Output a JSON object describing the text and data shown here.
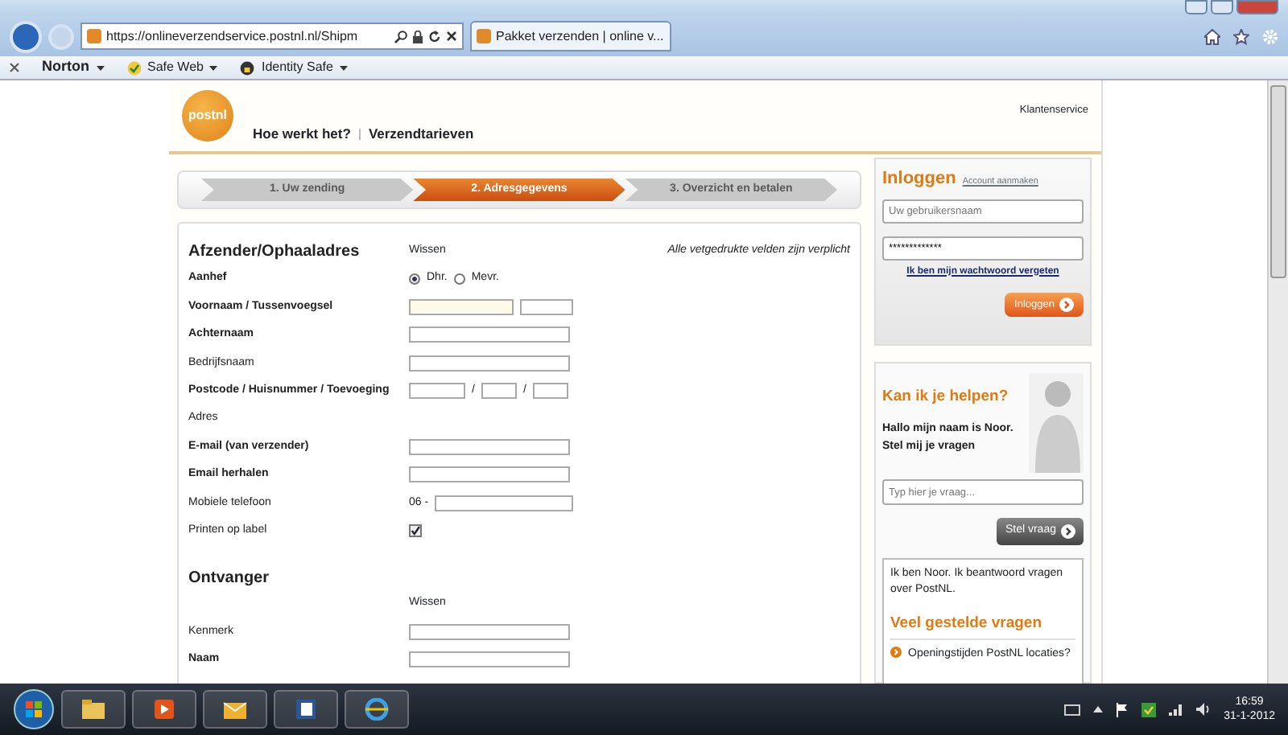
{
  "browser": {
    "address": "https://onlineverzendservice.postnl.nl/Shipm",
    "tab_title": "Pakket verzenden | online v...",
    "toolbar": [
      {
        "label": "Norton",
        "bold": true
      },
      {
        "label": "Safe Web",
        "bold": false
      },
      {
        "label": "Identity Safe",
        "bold": false
      }
    ]
  },
  "header": {
    "logo": "postnl",
    "nav": [
      "Hoe werkt het?",
      "Verzendtarieven"
    ],
    "service": "Klantenservice"
  },
  "steps": [
    {
      "label": "1. Uw zending",
      "selected": false
    },
    {
      "label": "2. Adresgegevens",
      "selected": true
    },
    {
      "label": "3. Overzicht en betalen",
      "selected": false
    }
  ],
  "sender": {
    "title": "Afzender/Ophaaladres",
    "clear": "Wissen",
    "required_note": "Alle vetgedrukte velden zijn verplicht",
    "fields": [
      {
        "label": "Aanhef",
        "bold": true,
        "kind": "radio",
        "options": [
          {
            "label": "Dhr.",
            "selected": true
          },
          {
            "label": "Mevr.",
            "selected": false
          }
        ]
      },
      {
        "label": "Voornaam / Tussenvoegsel",
        "bold": true,
        "kind": "split"
      },
      {
        "label": "Achternaam",
        "bold": true,
        "kind": "text"
      },
      {
        "label": "Bedrijfsnaam",
        "bold": false,
        "kind": "text"
      },
      {
        "label": "Postcode / Huisnummer / Toevoeging",
        "bold": true,
        "kind": "postcode",
        "separators": [
          "/",
          "/"
        ]
      },
      {
        "label": "Adres",
        "bold": false,
        "kind": "none"
      },
      {
        "label": "E-mail (van verzender)",
        "bold": true,
        "kind": "text"
      },
      {
        "label": "Email herhalen",
        "bold": true,
        "kind": "text"
      },
      {
        "label": "Mobiele telefoon",
        "bold": false,
        "kind": "phone",
        "prefix": "06 -"
      },
      {
        "label": "Printen op label",
        "bold": false,
        "kind": "checkbox",
        "checked": true
      }
    ]
  },
  "receiver": {
    "title": "Ontvanger",
    "clear": "Wissen",
    "fields": [
      {
        "label": "Kenmerk",
        "bold": false,
        "kind": "text"
      },
      {
        "label": "Naam",
        "bold": true,
        "kind": "text"
      }
    ]
  },
  "login": {
    "title": "Inloggen",
    "link": "Account aanmaken",
    "username_placeholder": "Uw gebruikersnaam",
    "password": "*************",
    "forgot": "Ik ben mijn wachtwoord vergeten",
    "button": "Inloggen"
  },
  "help": {
    "title": "Kan ik je helpen?",
    "intro": "Hallo mijn naam is Noor. Stel mij je vragen",
    "question_placeholder": "Typ hier je vraag...",
    "button": "Stel vraag",
    "answer": "Ik ben Noor. Ik beantwoord vragen over PostNL.",
    "faq_title": "Veel gestelde vragen",
    "faq": [
      "Openingstijden PostNL locaties?"
    ]
  },
  "taskbar": {
    "time": "16:59",
    "date": "31-1-2012"
  }
}
